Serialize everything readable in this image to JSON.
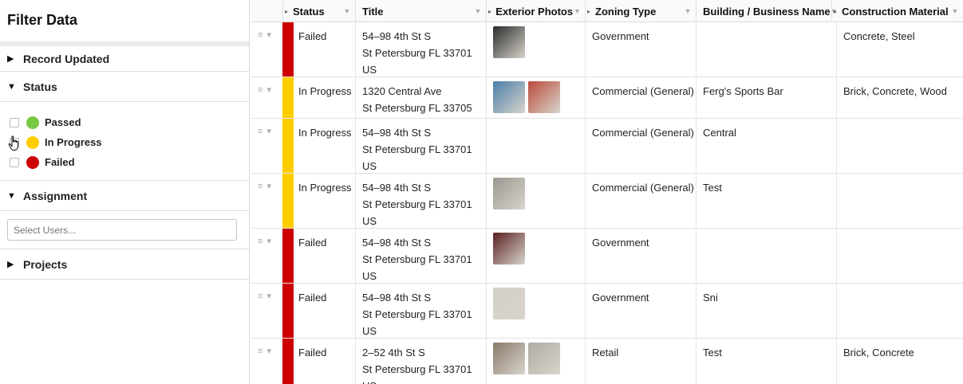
{
  "sidebar": {
    "title": "Filter Data",
    "sections": {
      "record_updated": "Record Updated",
      "status": "Status",
      "assignment": "Assignment",
      "projects": "Projects"
    },
    "status_options": [
      {
        "label": "Passed",
        "color": "#7ac943"
      },
      {
        "label": "In Progress",
        "color": "#ffcc00"
      },
      {
        "label": "Failed",
        "color": "#cc0000"
      }
    ],
    "assignment_placeholder": "Select Users..."
  },
  "table": {
    "columns": {
      "status": "Status",
      "title": "Title",
      "exterior_photos": "Exterior Photos",
      "zoning_type": "Zoning Type",
      "business_name": "Building / Business Name",
      "construction_material": "Construction Material"
    },
    "rows": [
      {
        "status": "Failed",
        "status_color": "#cc0000",
        "title": [
          "54–98 4th St S",
          "St Petersburg FL 33701",
          "US"
        ],
        "photos": [
          "#2a2a2a"
        ],
        "zoning": "Government",
        "name": "",
        "material": "Concrete, Steel"
      },
      {
        "status": "In Progress",
        "status_color": "#ffcc00",
        "title": [
          "1320 Central Ave",
          "St Petersburg FL 33705"
        ],
        "photos": [
          "#4a7fa8",
          "#b84a3a"
        ],
        "zoning": "Commercial (General)",
        "name": "Ferg's Sports Bar",
        "material": "Brick, Concrete, Wood"
      },
      {
        "status": "In Progress",
        "status_color": "#ffcc00",
        "title": [
          "54–98 4th St S",
          "St Petersburg FL 33701",
          "US"
        ],
        "photos": [],
        "zoning": "Commercial (General)",
        "name": "Central",
        "material": ""
      },
      {
        "status": "In Progress",
        "status_color": "#ffcc00",
        "title": [
          "54–98 4th St S",
          "St Petersburg FL 33701",
          "US"
        ],
        "photos": [
          "#9a9890"
        ],
        "zoning": "Commercial (General)",
        "name": "Test",
        "material": ""
      },
      {
        "status": "Failed",
        "status_color": "#cc0000",
        "title": [
          "54–98 4th St S",
          "St Petersburg FL 33701",
          "US"
        ],
        "photos": [
          "#5a2020"
        ],
        "zoning": "Government",
        "name": "",
        "material": ""
      },
      {
        "status": "Failed",
        "status_color": "#cc0000",
        "title": [
          "54–98 4th St S",
          "St Petersburg FL 33701",
          "US"
        ],
        "photos": [
          "#d4d0c8"
        ],
        "zoning": "Government",
        "name": "Sni",
        "material": ""
      },
      {
        "status": "Failed",
        "status_color": "#cc0000",
        "title": [
          "2–52 4th St S",
          "St Petersburg FL 33701",
          "US"
        ],
        "photos": [
          "#8a7a6a",
          "#b0aca4"
        ],
        "zoning": "Retail",
        "name": "Test",
        "material": "Brick, Concrete"
      }
    ]
  }
}
